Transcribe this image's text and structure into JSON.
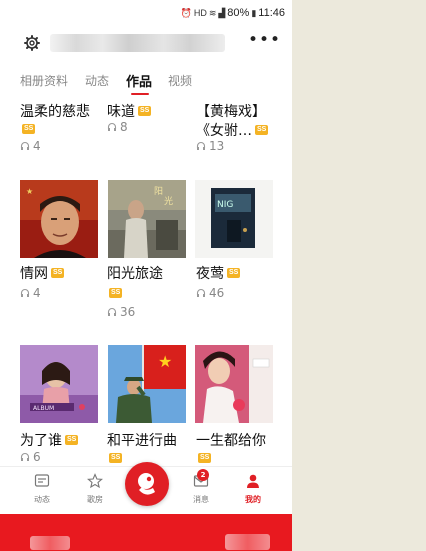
{
  "status_bar": {
    "signal": "HD",
    "battery": "80%",
    "time": "11:46"
  },
  "header": {
    "title": ""
  },
  "tabs": [
    {
      "label": "相册资料",
      "active": false
    },
    {
      "label": "动态",
      "active": false
    },
    {
      "label": "作品",
      "active": true
    },
    {
      "label": "视频",
      "active": false
    }
  ],
  "badge_text": "SS",
  "works": [
    {
      "title": "温柔的慈悲",
      "plays": "4",
      "badge_position": "under"
    },
    {
      "title": "味道",
      "plays": "8",
      "badge_position": "inline"
    },
    {
      "title": "【黄梅戏】",
      "title_line2": "《女驸…",
      "plays": "13",
      "badge_position": "inline"
    },
    {
      "title": "情网",
      "plays": "4",
      "badge_position": "inline"
    },
    {
      "title": "阳光旅途",
      "plays": "36",
      "badge_position": "under"
    },
    {
      "title": "夜莺",
      "plays": "46",
      "badge_position": "inline"
    },
    {
      "title": "为了谁",
      "plays": "6",
      "badge_position": "inline"
    },
    {
      "title": "和平进行曲",
      "plays": "",
      "badge_position": "under"
    },
    {
      "title": "一生都给你",
      "plays": "",
      "badge_position": "under"
    }
  ],
  "bottom_nav": [
    {
      "label": "动态",
      "icon": "feed-icon",
      "active": false
    },
    {
      "label": "歌房",
      "icon": "star-icon",
      "active": false
    },
    {
      "label": "消息",
      "icon": "mail-icon",
      "active": false,
      "badge": "2"
    },
    {
      "label": "我的",
      "icon": "person-icon",
      "active": true
    }
  ],
  "colors": {
    "accent": "#e01f25",
    "badge": "#f4b324",
    "muted": "#888888",
    "background_side": "#ece9dc"
  }
}
